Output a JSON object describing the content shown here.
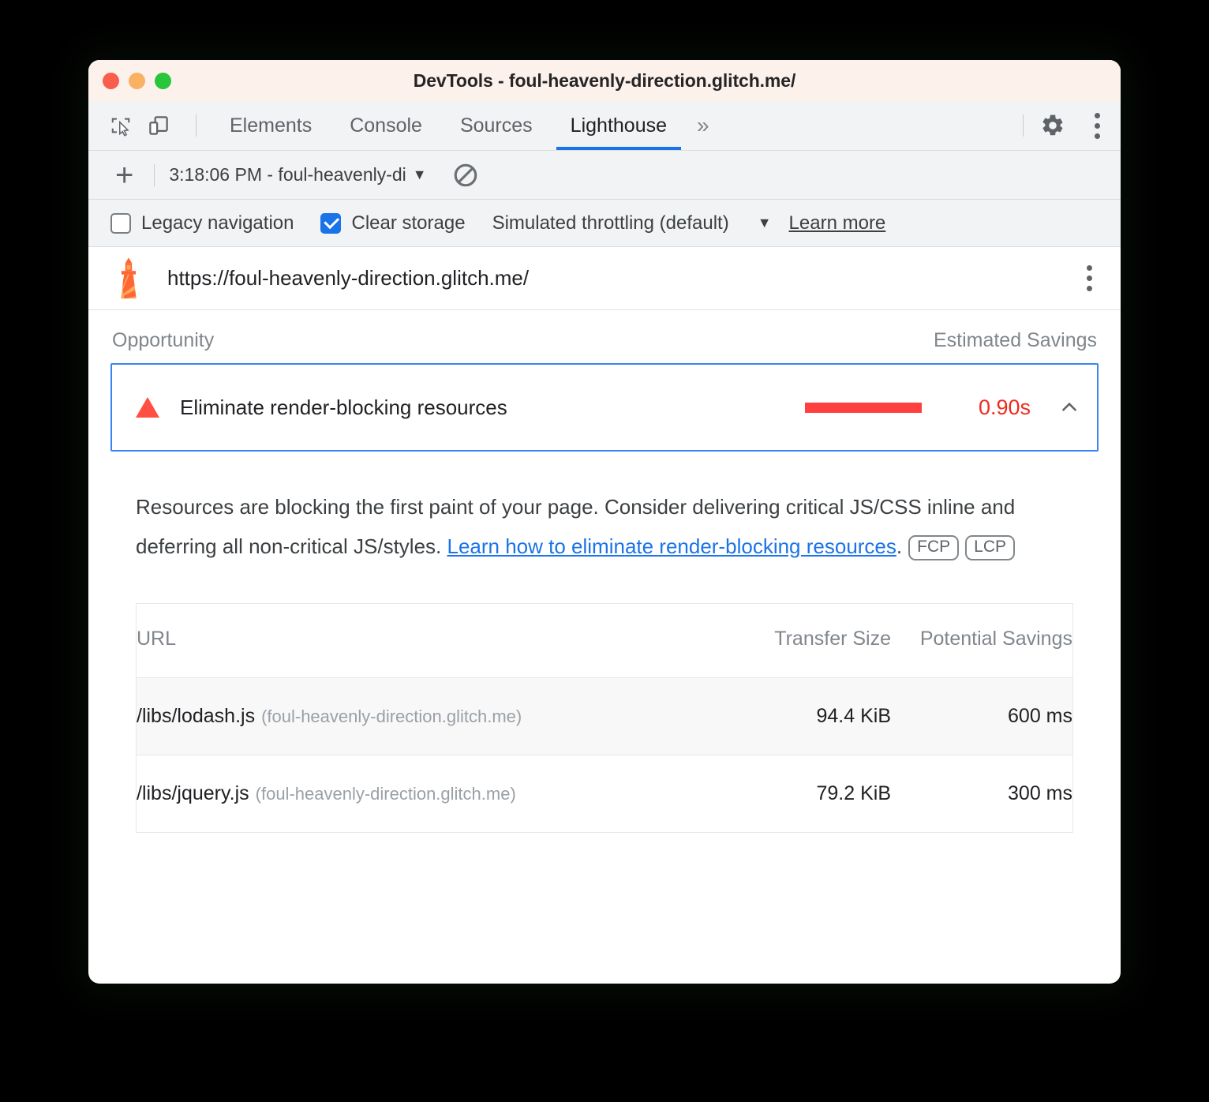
{
  "window": {
    "title": "DevTools - foul-heavenly-direction.glitch.me/",
    "traffic_lights": [
      "close",
      "minimize",
      "zoom"
    ]
  },
  "devtools": {
    "icons": {
      "inspect": "inspect-element-icon",
      "device": "device-toolbar-icon",
      "settings": "gear-icon",
      "menu": "kebab-menu-icon",
      "overflow": "more-tabs-icon"
    },
    "overflow_label": "»",
    "tabs": [
      {
        "label": "Elements",
        "active": false
      },
      {
        "label": "Console",
        "active": false
      },
      {
        "label": "Sources",
        "active": false
      },
      {
        "label": "Lighthouse",
        "active": true
      }
    ],
    "accent_color": "#1a73e8"
  },
  "run_toolbar": {
    "add_label": "+",
    "report_select_value": "3:18:06 PM - foul-heavenly-di",
    "caret": "▼",
    "clear_icon": "no-entry-clear-icon"
  },
  "options": {
    "legacy_navigation": {
      "label": "Legacy navigation",
      "checked": false
    },
    "clear_storage": {
      "label": "Clear storage",
      "checked": true
    },
    "throttling": {
      "label": "Simulated throttling (default)",
      "caret": "▼"
    },
    "learn_more": "Learn more"
  },
  "url_header": {
    "logo": "lighthouse-logo",
    "url": "https://foul-heavenly-direction.glitch.me/",
    "menu": "kebab-menu-icon"
  },
  "report": {
    "columns": {
      "opportunity": "Opportunity",
      "estimated_savings": "Estimated Savings"
    },
    "opportunity": {
      "severity_icon": "warning-triangle-icon",
      "severity_color": "#ff4e42",
      "title": "Eliminate render-blocking resources",
      "savings_value": "0.90s",
      "savings_color": "#f02b1d",
      "bar_color": "#ff4040",
      "expanded": true,
      "collapse_icon": "chevron-up-icon"
    },
    "description": {
      "text_before": "Resources are blocking the first paint of your page. Consider delivering critical JS/CSS inline and deferring all non-critical JS/styles. ",
      "link_text": "Learn how to eliminate render-blocking resources",
      "text_after": ".",
      "badges": [
        "FCP",
        "LCP"
      ]
    },
    "table": {
      "headers": {
        "url": "URL",
        "transfer_size": "Transfer Size",
        "potential_savings": "Potential Savings"
      },
      "rows": [
        {
          "url": "/libs/lodash.js",
          "origin": "(foul-heavenly-direction.glitch.me)",
          "transfer_size": "94.4 KiB",
          "potential_savings": "600 ms"
        },
        {
          "url": "/libs/jquery.js",
          "origin": "(foul-heavenly-direction.glitch.me)",
          "transfer_size": "79.2 KiB",
          "potential_savings": "300 ms"
        }
      ]
    }
  }
}
